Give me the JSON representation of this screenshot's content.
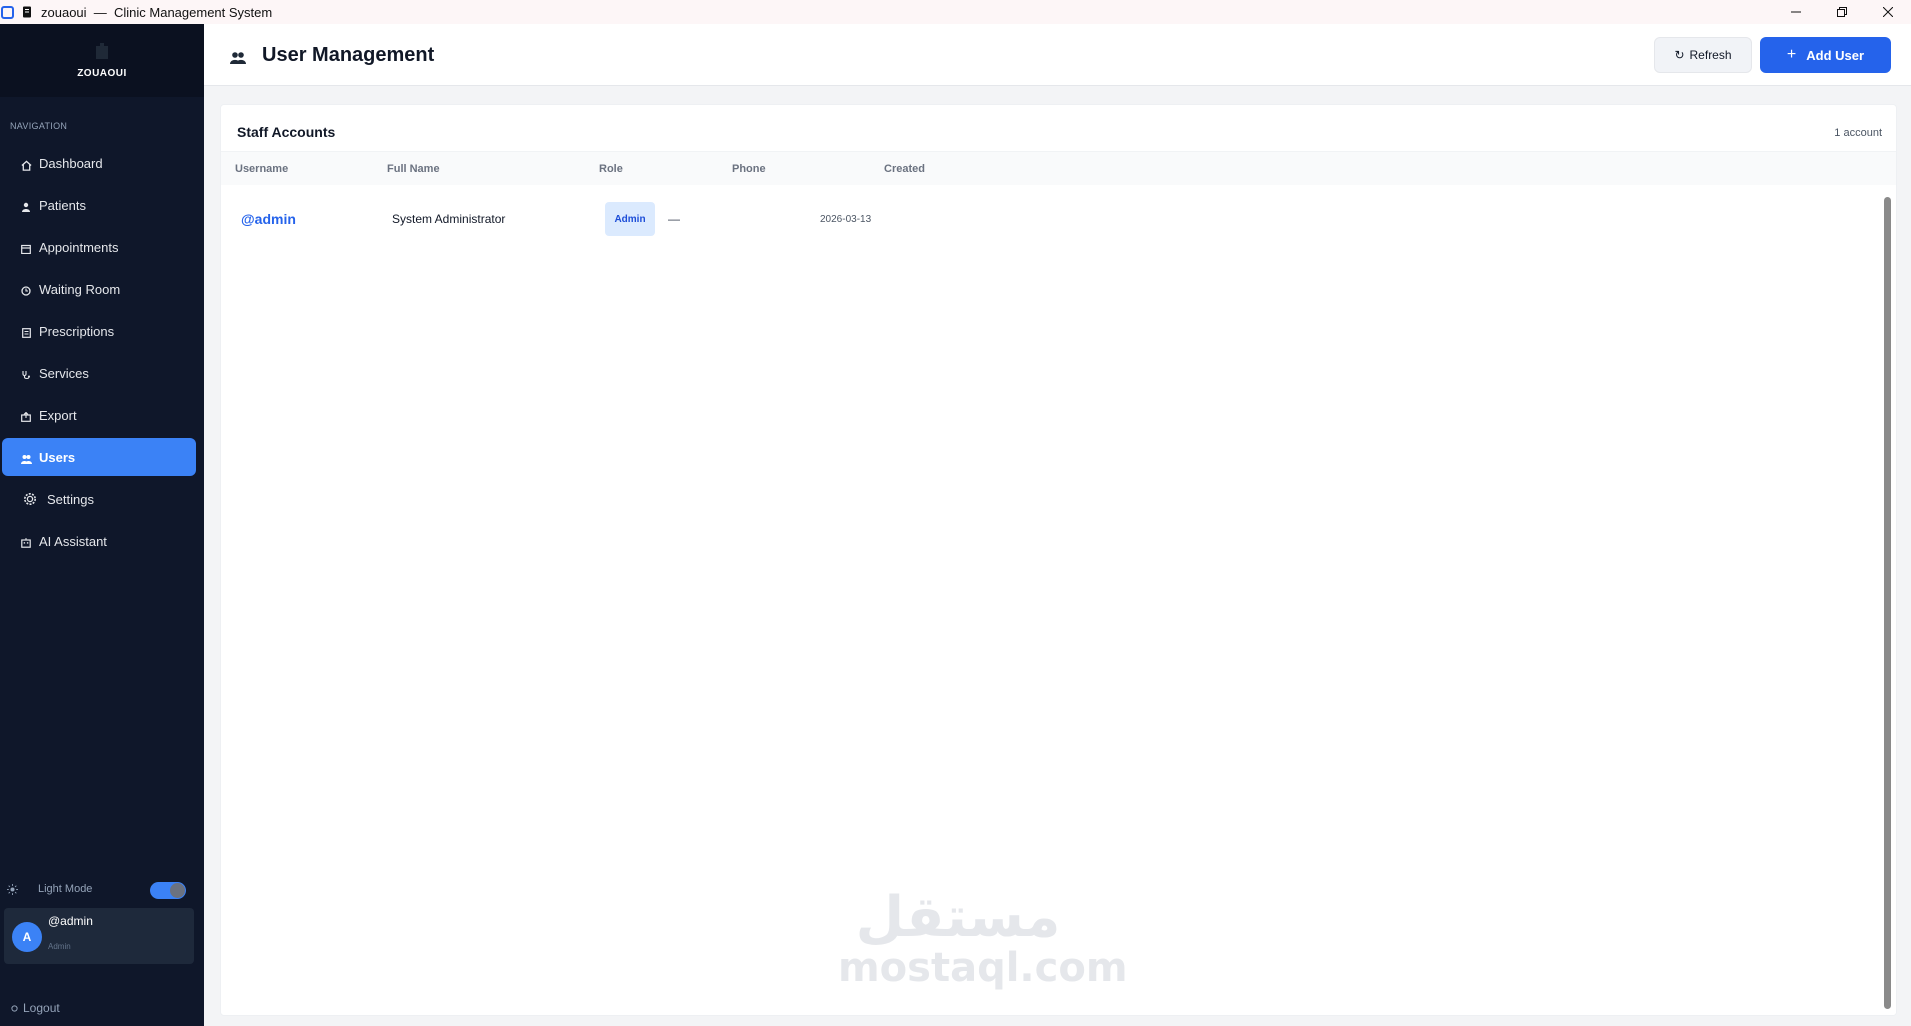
{
  "window": {
    "title": "zouaoui  —  Clinic Management System"
  },
  "brand": {
    "name": "ZOUAOUI"
  },
  "sidebar": {
    "section_label": "NAVIGATION",
    "items": [
      {
        "label": "Dashboard",
        "icon": "home-icon"
      },
      {
        "label": "Patients",
        "icon": "person-icon"
      },
      {
        "label": "Appointments",
        "icon": "calendar-icon"
      },
      {
        "label": "Waiting Room",
        "icon": "clock-icon"
      },
      {
        "label": "Prescriptions",
        "icon": "clipboard-icon"
      },
      {
        "label": "Services",
        "icon": "stethoscope-icon"
      },
      {
        "label": "Export",
        "icon": "export-icon"
      },
      {
        "label": "Users",
        "icon": "users-icon",
        "active": true
      },
      {
        "label": "Settings",
        "icon": "gear-icon"
      },
      {
        "label": "AI Assistant",
        "icon": "robot-icon"
      }
    ],
    "theme_label": "Light Mode",
    "user": {
      "avatar_letter": "A",
      "username": "@admin",
      "role": "Admin"
    },
    "logout_label": "Logout"
  },
  "header": {
    "title": "User Management",
    "refresh_label": "Refresh",
    "add_user_label": "Add User"
  },
  "staff_accounts": {
    "title": "Staff Accounts",
    "count_label": "1 account",
    "columns": [
      "Username",
      "Full Name",
      "Role",
      "Phone",
      "Created"
    ],
    "rows": [
      {
        "username": "@admin",
        "full_name": "System Administrator",
        "role": "Admin",
        "phone": "—",
        "created": "2026-03-13"
      }
    ]
  },
  "watermark": {
    "arabic": "مستقل",
    "latin": "mostaql.com"
  },
  "colors": {
    "sidebar_bg": "#0f172a",
    "accent": "#2563eb",
    "active_nav": "#3b82f6",
    "role_badge_bg": "#dbeafe"
  }
}
